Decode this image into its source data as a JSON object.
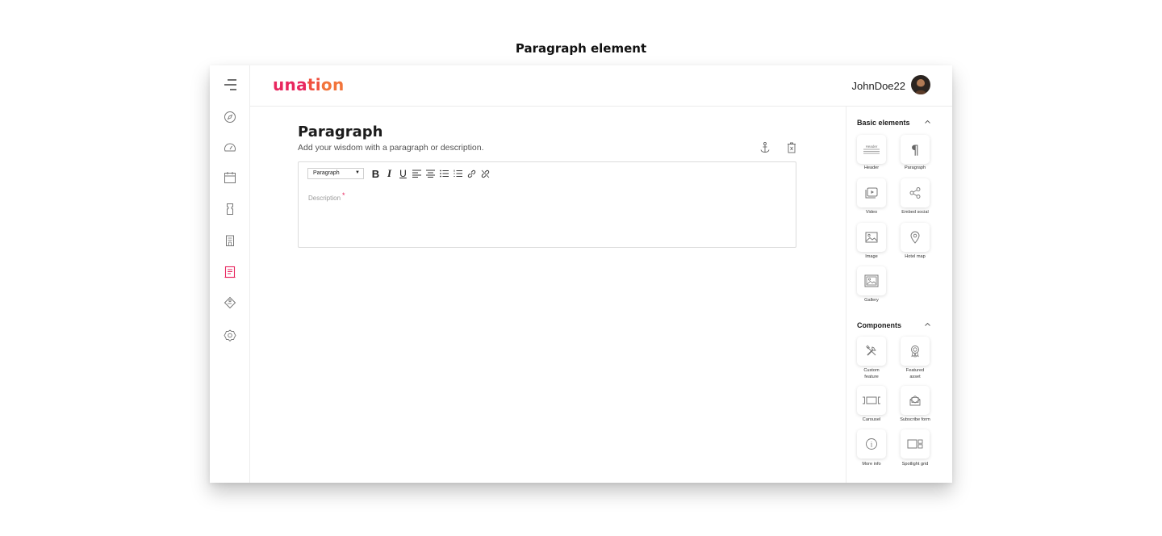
{
  "caption": "Paragraph element",
  "brand": {
    "logo_parts": [
      "una",
      "ti",
      "on"
    ],
    "colors": {
      "brand_pink": "#e8275f",
      "brand_orange": "#f2743a"
    }
  },
  "header": {
    "username": "JohnDoe22"
  },
  "sidebar": {
    "items": [
      {
        "icon": "compass-icon"
      },
      {
        "icon": "gauge-icon"
      },
      {
        "icon": "calendar-icon"
      },
      {
        "icon": "ticket-icon"
      },
      {
        "icon": "building-icon"
      },
      {
        "icon": "document-icon",
        "active": true
      },
      {
        "icon": "tag-icon"
      },
      {
        "icon": "badge-icon"
      }
    ]
  },
  "editor": {
    "title": "Paragraph",
    "subtitle": "Add your wisdom with a paragraph or description.",
    "format_select": "Paragraph",
    "toolbar": {
      "bold": "B",
      "italic": "I",
      "underline": "U"
    },
    "placeholder": "Description",
    "required_mark": "*"
  },
  "panel": {
    "basic_title": "Basic elements",
    "basic_items": [
      {
        "label": "Header",
        "icon": "header-icon",
        "icon_text": "Header"
      },
      {
        "label": "Paragraph",
        "icon": "pilcrow-icon",
        "icon_text": "¶"
      },
      {
        "label": "Video",
        "icon": "video-icon"
      },
      {
        "label": "Embed social",
        "icon": "share-icon"
      },
      {
        "label": "Image",
        "icon": "image-icon"
      },
      {
        "label": "Hotel map",
        "icon": "map-pin-icon"
      },
      {
        "label": "Gallery",
        "icon": "gallery-icon"
      }
    ],
    "components_title": "Components",
    "component_items": [
      {
        "label": "Custom feature",
        "label_lines": [
          "Custom",
          "feature"
        ],
        "icon": "tools-icon"
      },
      {
        "label": "Featured asset",
        "label_lines": [
          "Featured",
          "asset"
        ],
        "icon": "award-icon"
      },
      {
        "label": "Carousel",
        "icon": "carousel-icon"
      },
      {
        "label": "Subscribe form",
        "icon": "mail-icon"
      },
      {
        "label": "More info",
        "icon": "info-icon",
        "icon_text": "i"
      },
      {
        "label": "Spotlight grid",
        "icon": "grid-icon"
      }
    ]
  }
}
